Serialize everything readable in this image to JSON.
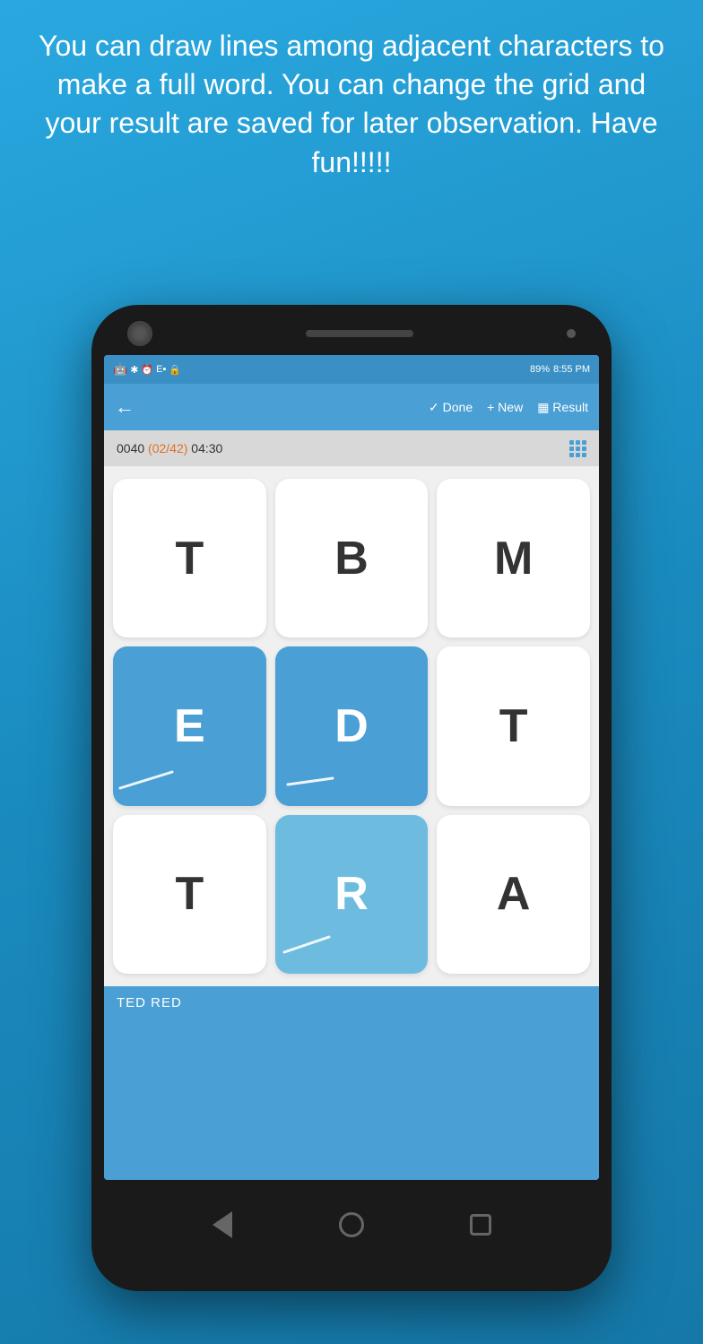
{
  "header": {
    "text": "You can draw lines among adjacent characters to make a full word. You can change the grid and your result are saved for later observation. Have fun!!!!!"
  },
  "statusBar": {
    "androidIcon": "🤖",
    "bluetooth": "✱",
    "clock": "⏰",
    "signal": "E",
    "lock": "?",
    "battery": "89%",
    "time": "8:55 PM"
  },
  "toolbar": {
    "backIcon": "←",
    "doneLabel": "✓ Done",
    "newLabel": "+ New",
    "resultLabel": "▦ Result"
  },
  "subHeader": {
    "code": "0040",
    "progress": "(02/42)",
    "timer": "04:30"
  },
  "grid": {
    "cells": [
      {
        "letter": "T",
        "active": false
      },
      {
        "letter": "B",
        "active": false
      },
      {
        "letter": "M",
        "active": false
      },
      {
        "letter": "E",
        "active": true,
        "style": "active-blue"
      },
      {
        "letter": "D",
        "active": true,
        "style": "active-blue"
      },
      {
        "letter": "T",
        "active": false
      },
      {
        "letter": "T",
        "active": false
      },
      {
        "letter": "R",
        "active": true,
        "style": "active-light"
      },
      {
        "letter": "A",
        "active": false
      }
    ]
  },
  "words": {
    "list": [
      "TED",
      "RED"
    ]
  },
  "nav": {
    "back": "◁",
    "home": "○",
    "recent": "□"
  }
}
